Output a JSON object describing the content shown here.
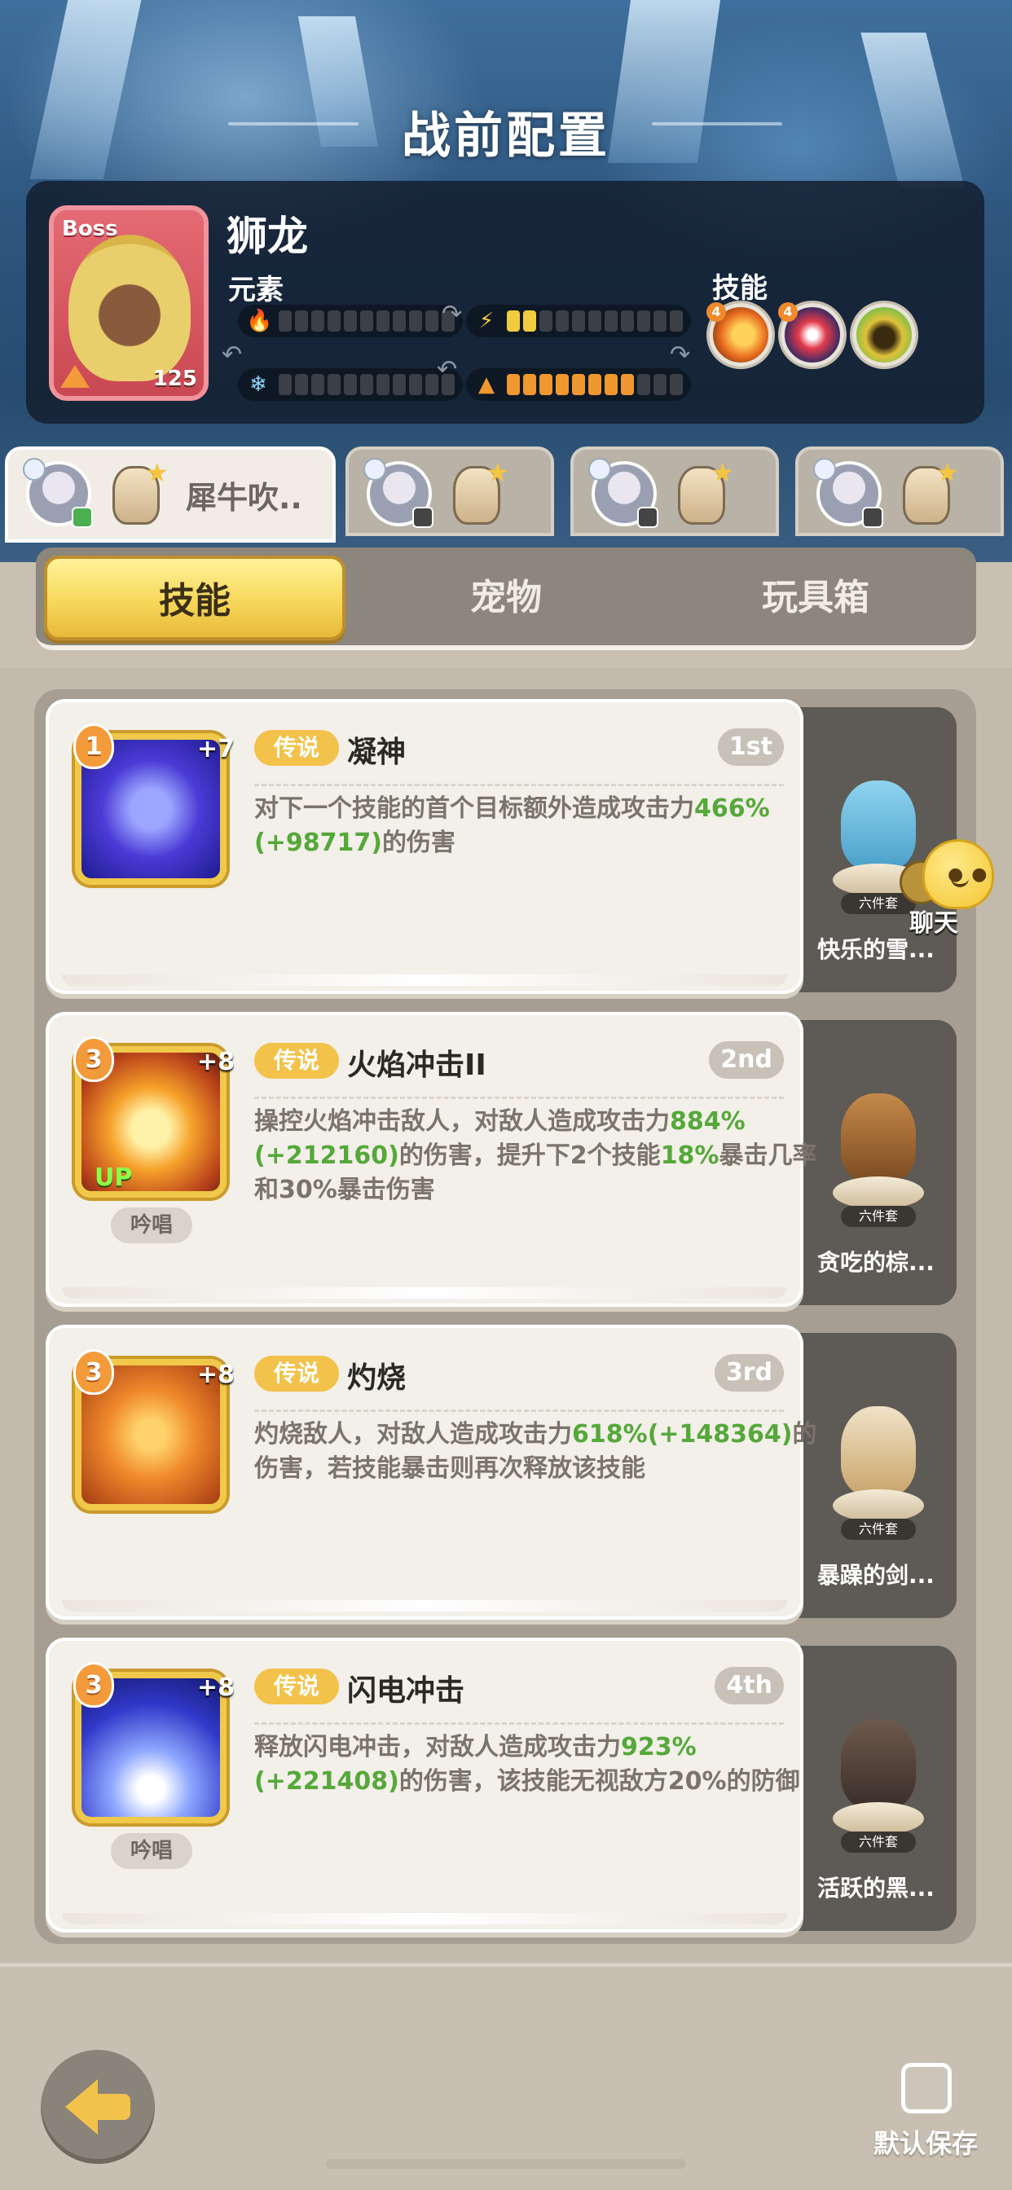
{
  "screen": {
    "title": "战前配置"
  },
  "boss": {
    "card_label": "Boss",
    "level": "125",
    "name": "狮龙",
    "element_label": "元素",
    "skill_label": "技能",
    "meters": [
      {
        "icon": "fire-icon",
        "filled": 0,
        "total": 11,
        "color": "#f0972f"
      },
      {
        "icon": "lightning-icon",
        "filled": 2,
        "total": 11,
        "color": "#f2cc3c"
      },
      {
        "icon": "snowflake-icon",
        "filled": 0,
        "total": 11,
        "color": "#f0972f"
      },
      {
        "icon": "earth-icon",
        "filled": 8,
        "total": 11,
        "color": "#f0972f"
      }
    ],
    "skill_orbs": [
      {
        "name": "fire-orb-icon",
        "badge": "4"
      },
      {
        "name": "red-bird-orb-icon",
        "badge": "4"
      },
      {
        "name": "green-creature-orb-icon",
        "badge": ""
      }
    ]
  },
  "hero_tabs": [
    {
      "name": "犀牛吹..",
      "active": true
    },
    {
      "name": "",
      "active": false
    },
    {
      "name": "",
      "active": false
    },
    {
      "name": "",
      "active": false
    }
  ],
  "sub_tabs": [
    "技能",
    "宠物",
    "玩具箱"
  ],
  "skills": [
    {
      "level": "1",
      "plus": "+7",
      "rarity": "传说",
      "name": "凝神",
      "order": "1st",
      "desc_parts": [
        "对下一个技能的首个目标额外造成攻击力",
        "466%",
        "(+98717)",
        "的伤害"
      ],
      "chant": "",
      "up": "",
      "pet": "快乐的雪...",
      "set": "六件套"
    },
    {
      "level": "3",
      "plus": "+8",
      "rarity": "传说",
      "name": "火焰冲击II",
      "order": "2nd",
      "desc_parts": [
        "操控火焰冲击敌人，对敌人造成攻击力",
        "884%",
        "(+212160)",
        "的伤害，提升下2个技能",
        "18%",
        "暴击几率和30%暴击伤害"
      ],
      "chant": "吟唱",
      "up": "UP",
      "pet": "贪吃的棕...",
      "set": "六件套"
    },
    {
      "level": "3",
      "plus": "+8",
      "rarity": "传说",
      "name": "灼烧",
      "order": "3rd",
      "desc_parts": [
        "灼烧敌人，对敌人造成攻击力",
        "618%",
        "(+148364)",
        "的伤害，若技能暴击则再次释放该技能"
      ],
      "chant": "",
      "up": "",
      "pet": "暴躁的剑...",
      "set": "六件套"
    },
    {
      "level": "3",
      "plus": "+8",
      "rarity": "传说",
      "name": "闪电冲击",
      "order": "4th",
      "desc_parts": [
        "释放闪电冲击，对敌人造成攻击力",
        "923%",
        "(+221408)",
        "的伤害，该技能无视敌方20%的防御"
      ],
      "chant": "吟唱",
      "up": "",
      "pet": "活跃的黑...",
      "set": "六件套"
    }
  ],
  "chat": {
    "label": "聊天"
  },
  "footer": {
    "save_label": "默认保存"
  }
}
